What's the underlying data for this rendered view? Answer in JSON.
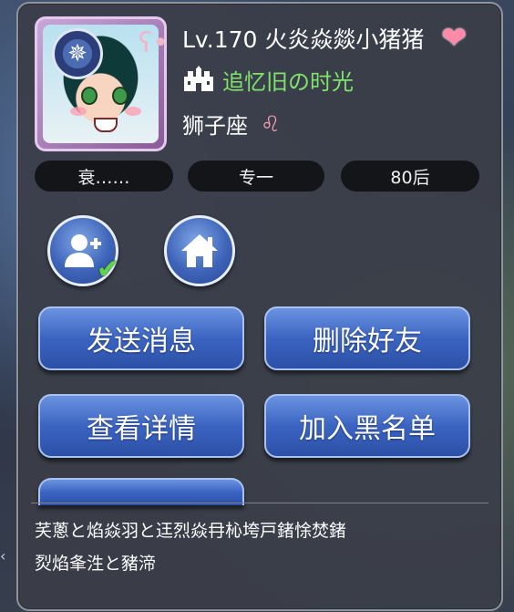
{
  "profile": {
    "level": "Lv.170",
    "name": "火炎焱燚小猪猪",
    "guild": "追忆旧の时光",
    "zodiac": "狮子座",
    "zodiac_symbol": "♌",
    "heart_symbol": "❤"
  },
  "tags": [
    "衰……",
    "专一",
    "80后"
  ],
  "icon_buttons": {
    "add_friend": "add-friend-icon",
    "home": "home-icon"
  },
  "actions": {
    "send_message": "发送消息",
    "delete_friend": "删除好友",
    "view_details": "查看详情",
    "add_blacklist": "加入黑名单"
  },
  "bio": {
    "line1": "芺蔥と焰焱羽と迋烈焱冄杺垮戸鍺悇焚鍺",
    "line2": "烮焰夆泩と豬渧"
  },
  "colors": {
    "panel": "#3a3e48",
    "guild_green": "#7fe36c",
    "button_blue": "#3b64c2",
    "heart_pink": "#ff8aa8"
  }
}
